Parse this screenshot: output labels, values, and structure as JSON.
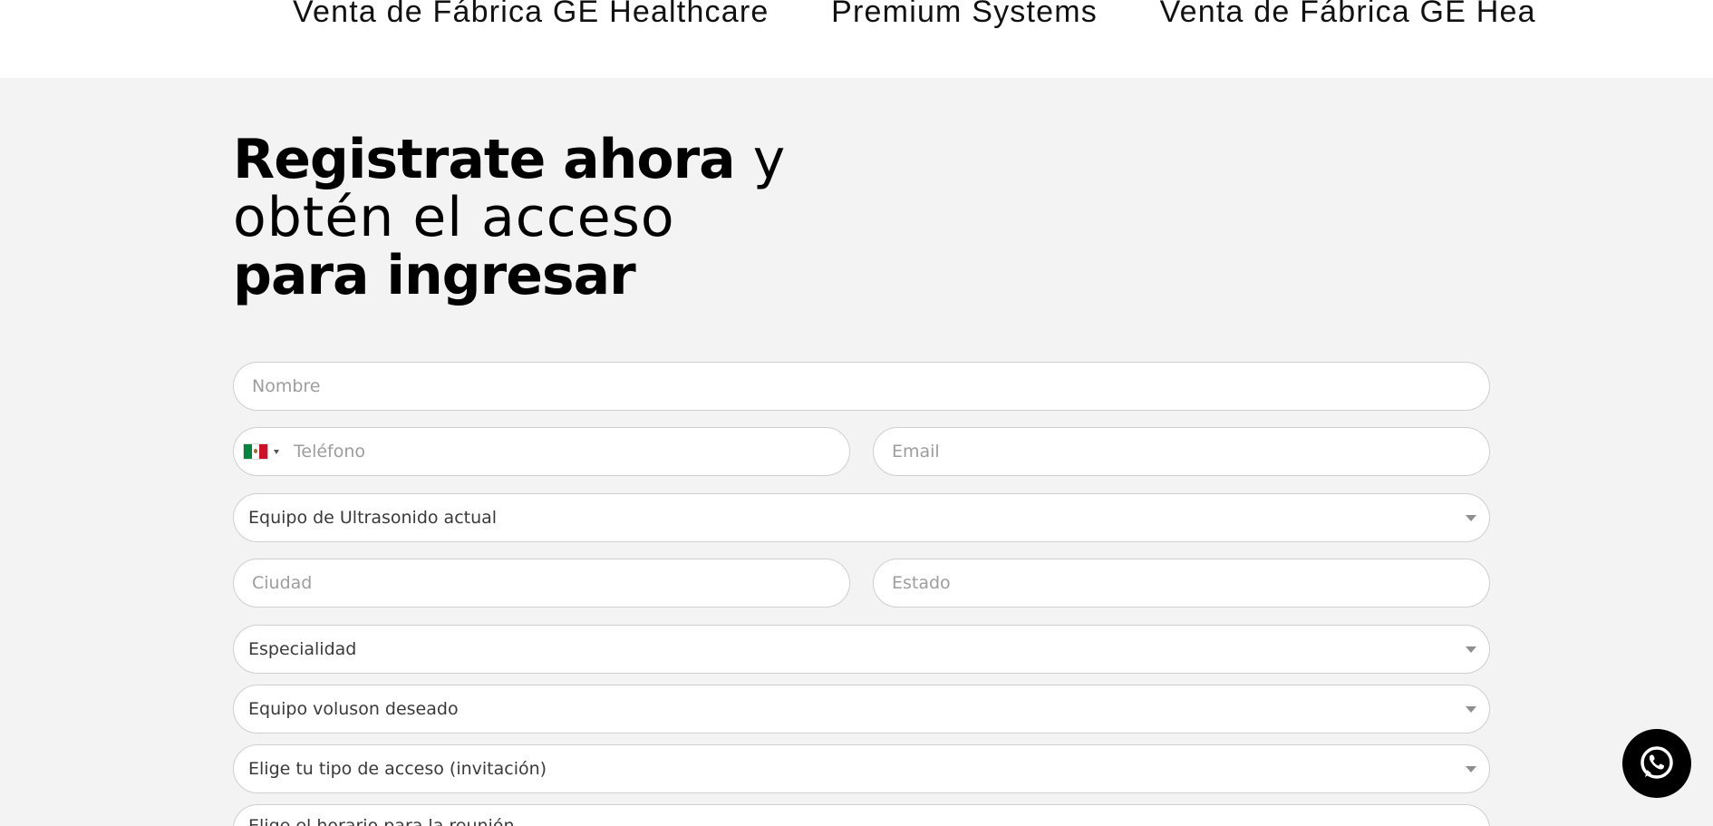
{
  "marquee": {
    "items": [
      "Venta de Fábrica GE Healthcare",
      "Premium Systems",
      "Venta de Fábrica GE Hea"
    ]
  },
  "headline": {
    "part1_bold": "Registrate ahora",
    "part1_light": " y",
    "line2": "obtén el acceso",
    "line3": "para ingresar"
  },
  "form": {
    "nombre_placeholder": "Nombre",
    "telefono_placeholder": "Teléfono",
    "email_placeholder": "Email",
    "equipo_actual_label": "Equipo de Ultrasonido actual",
    "ciudad_placeholder": "Ciudad",
    "estado_placeholder": "Estado",
    "especialidad_label": "Especialidad",
    "equipo_deseado_label": "Equipo voluson deseado",
    "tipo_acceso_label": "Elige tu tipo de acceso (invitación)",
    "ultimo_label": "Elige el horario para la reunión"
  },
  "icons": {
    "country_flag": "mexico-flag-icon",
    "whatsapp": "whatsapp-icon"
  },
  "colors": {
    "background": "#f3f3f3",
    "field_border": "#cfcfcf",
    "whatsapp_button": "#000000"
  }
}
